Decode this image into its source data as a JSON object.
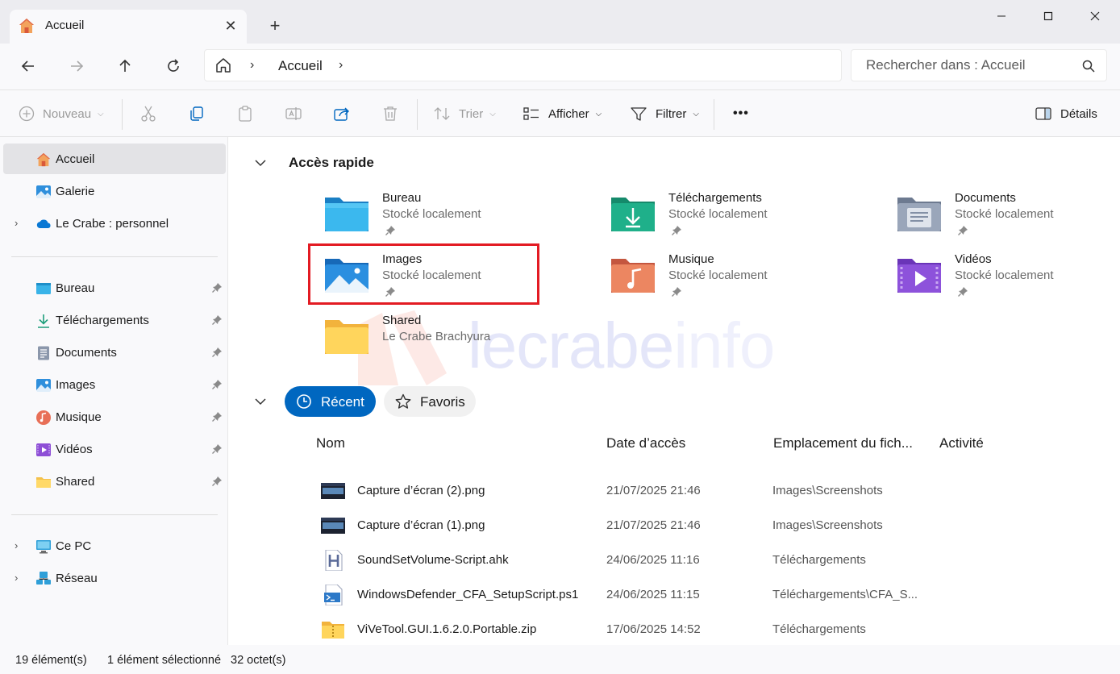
{
  "window": {
    "tab_title": "Accueil",
    "tab_close": "✕",
    "new_tab": "+"
  },
  "nav": {
    "breadcrumb": "Accueil",
    "search_placeholder": "Rechercher dans : Accueil"
  },
  "toolbar": {
    "new_label": "Nouveau",
    "sort_label": "Trier",
    "view_label": "Afficher",
    "filter_label": "Filtrer",
    "more_label": "•••",
    "details_label": "Détails"
  },
  "sidebar": {
    "top": [
      {
        "label": "Accueil",
        "icon": "home-icon"
      },
      {
        "label": "Galerie",
        "icon": "gallery-icon"
      },
      {
        "label": "Le Crabe : personnel",
        "icon": "onedrive-icon"
      }
    ],
    "pinned": [
      {
        "label": "Bureau",
        "icon": "desktop-folder-icon"
      },
      {
        "label": "Téléchargements",
        "icon": "downloads-icon"
      },
      {
        "label": "Documents",
        "icon": "documents-icon"
      },
      {
        "label": "Images",
        "icon": "pictures-icon"
      },
      {
        "label": "Musique",
        "icon": "music-icon"
      },
      {
        "label": "Vidéos",
        "icon": "videos-icon"
      },
      {
        "label": "Shared",
        "icon": "folder-icon"
      }
    ],
    "bottom": [
      {
        "label": "Ce PC",
        "icon": "computer-icon"
      },
      {
        "label": "Réseau",
        "icon": "network-icon"
      }
    ]
  },
  "quick_access": {
    "title": "Accès rapide",
    "tiles": [
      {
        "name": "Bureau",
        "sub": "Stocké localement"
      },
      {
        "name": "Téléchargements",
        "sub": "Stocké localement"
      },
      {
        "name": "Documents",
        "sub": "Stocké localement"
      },
      {
        "name": "Images",
        "sub": "Stocké localement"
      },
      {
        "name": "Musique",
        "sub": "Stocké localement"
      },
      {
        "name": "Vidéos",
        "sub": "Stocké localement"
      },
      {
        "name": "Shared",
        "sub": "Le Crabe Brachyura"
      }
    ]
  },
  "watermark": {
    "part1": "lecrabe",
    "part2": "info"
  },
  "recent": {
    "tab_recent": "Récent",
    "tab_favorites": "Favoris",
    "columns": [
      "Nom",
      "Date d’accès",
      "Emplacement du fich...",
      "Activité"
    ],
    "rows": [
      {
        "name": "Capture d’écran (2).png",
        "date": "21/07/2025 21:46",
        "location": "Images\\Screenshots",
        "icon": "image-file-icon"
      },
      {
        "name": "Capture d’écran (1).png",
        "date": "21/07/2025 21:46",
        "location": "Images\\Screenshots",
        "icon": "image-file-icon"
      },
      {
        "name": "SoundSetVolume-Script.ahk",
        "date": "24/06/2025 11:16",
        "location": "Téléchargements",
        "icon": "ahk-file-icon"
      },
      {
        "name": "WindowsDefender_CFA_SetupScript.ps1",
        "date": "24/06/2025 11:15",
        "location": "Téléchargements\\CFA_S...",
        "icon": "powershell-file-icon"
      },
      {
        "name": "ViVeTool.GUI.1.6.2.0.Portable.zip",
        "date": "17/06/2025 14:52",
        "location": "Téléchargements",
        "icon": "zip-file-icon"
      }
    ]
  },
  "status": {
    "count": "19 élément(s)",
    "selected": "1 élément sélectionné",
    "size": "32 octet(s)"
  },
  "colors": {
    "accent": "#0067c0",
    "highlight_box": "#e31b23"
  }
}
